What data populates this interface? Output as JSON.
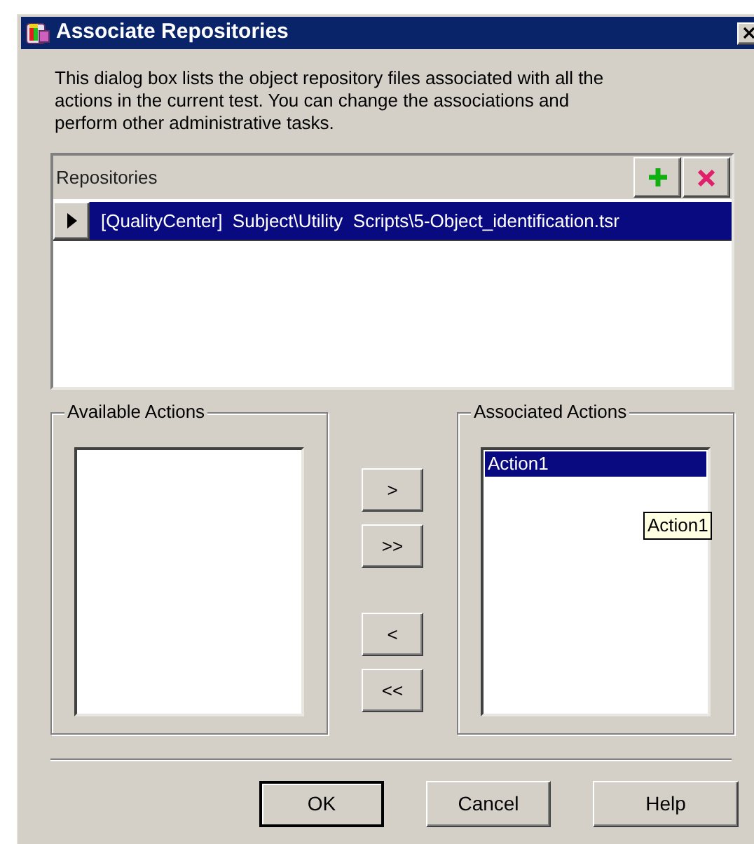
{
  "window": {
    "title": "Associate Repositories"
  },
  "description": "This dialog box lists the object repository files associated with all the actions in the current test. You can change the associations and perform other administrative tasks.",
  "repositories": {
    "header": "Repositories",
    "rows": [
      {
        "text": "[QualityCenter]  Subject\\Utility  Scripts\\5-Object_identification.tsr",
        "selected": true
      }
    ]
  },
  "available_actions": {
    "label": "Available Actions"
  },
  "move_buttons": [
    ">",
    ">>",
    "<",
    "<<"
  ],
  "associated_actions": {
    "label": "Associated Actions",
    "items": [
      {
        "text": "Action1",
        "selected": true
      }
    ]
  },
  "tooltip": "Action1",
  "buttons": [
    {
      "label": "OK",
      "default": true
    },
    {
      "label": "Cancel",
      "default": false
    },
    {
      "label": "Help",
      "default": false
    }
  ]
}
